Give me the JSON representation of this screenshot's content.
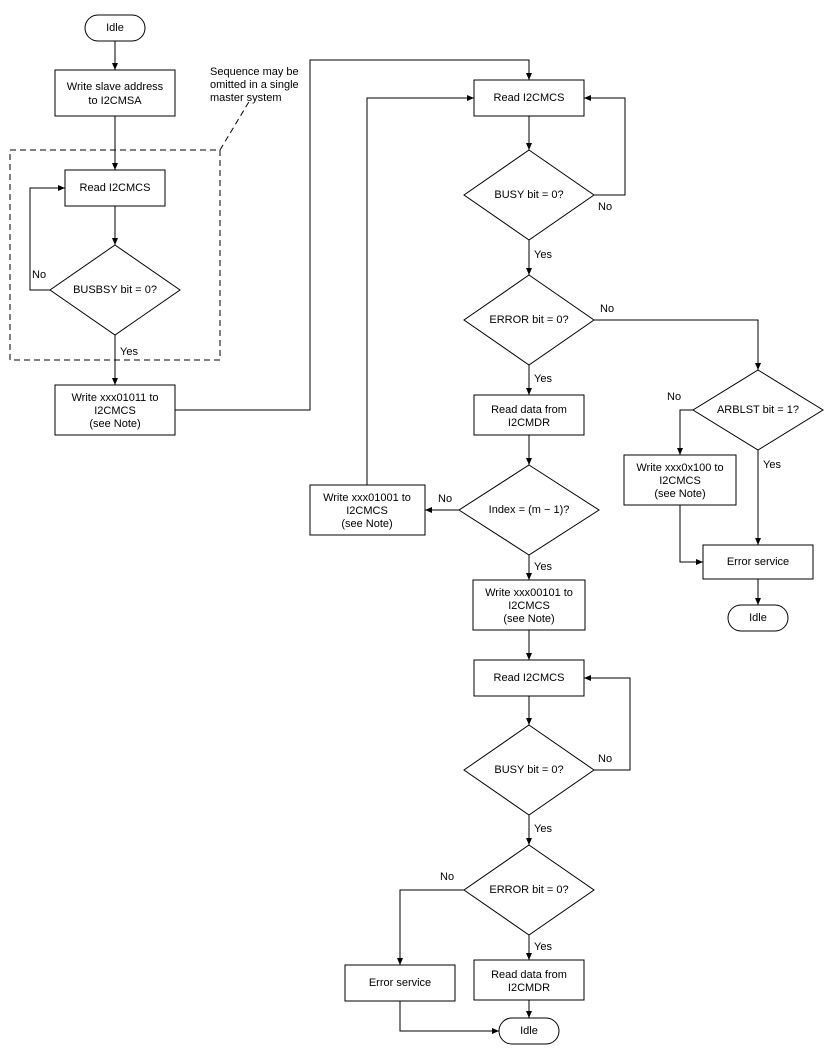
{
  "terminals": {
    "idle_top": "Idle",
    "idle_right": "Idle",
    "idle_bottom": "Idle"
  },
  "processes": {
    "write_slave_1": "Write slave address",
    "write_slave_2": "to I2CMSA",
    "read_cs_left": "Read I2CMCS",
    "write_01011_1": "Write xxx01011 to",
    "write_01011_2": "I2CMCS",
    "write_01011_3": "(see Note)",
    "read_cs_top": "Read I2CMCS",
    "read_data_1": "Read data from",
    "read_data_2": "I2CMDR",
    "write_01001_1": "Write xxx01001 to",
    "write_01001_2": "I2CMCS",
    "write_01001_3": "(see Note)",
    "write_00101_1": "Write xxx00101 to",
    "write_00101_2": "I2CMCS",
    "write_00101_3": "(see Note)",
    "read_cs_mid": "Read I2CMCS",
    "write_0x100_1": "Write xxx0x100 to",
    "write_0x100_2": "I2CMCS",
    "write_0x100_3": "(see Note)",
    "error_right": "Error service",
    "error_left": "Error service",
    "read_data_b1": "Read data from",
    "read_data_b2": "I2CMDR"
  },
  "decisions": {
    "busbsy": "BUSBSY bit = 0?",
    "busy1": "BUSY bit = 0?",
    "error1": "ERROR bit = 0?",
    "index": "Index = (m − 1)?",
    "busy2": "BUSY bit = 0?",
    "error2": "ERROR bit = 0?",
    "arblst": "ARBLST bit = 1?"
  },
  "labels": {
    "yes": "Yes",
    "no": "No"
  },
  "note_1": "Sequence may be",
  "note_2": "omitted in a single",
  "note_3": "master system"
}
